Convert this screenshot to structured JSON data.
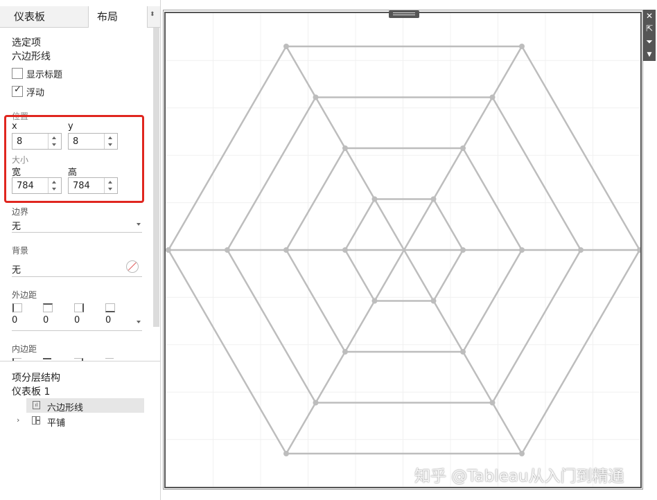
{
  "tabs": {
    "dashboard": "仪表板",
    "layout": "布局"
  },
  "selected": {
    "heading": "选定项",
    "name": "六边形线"
  },
  "options": {
    "show_title": "显示标题",
    "floating": "浮动",
    "floating_checked": true,
    "show_title_checked": false
  },
  "position": {
    "heading": "位置",
    "x_label": "x",
    "y_label": "y",
    "x": "8",
    "y": "8"
  },
  "size": {
    "heading": "大小",
    "w_label": "宽",
    "h_label": "高",
    "w": "784",
    "h": "784"
  },
  "border": {
    "heading": "边界",
    "value": "无"
  },
  "background": {
    "heading": "背景",
    "value": "无"
  },
  "outer_padding": {
    "heading": "外边距",
    "values": [
      "0",
      "0",
      "0",
      "0"
    ]
  },
  "inner_padding": {
    "heading": "内边距"
  },
  "hierarchy": {
    "heading": "项分层结构",
    "dashboard": "仪表板 1",
    "items": [
      "六边形线",
      "平铺"
    ]
  },
  "watermark": "知乎 @Tableau从入门到精通",
  "colors": {
    "highlight": "#e0261f",
    "line": "#bdbdbd",
    "selected_row": "#e6e6e6"
  },
  "toolbar_icons": [
    "close-icon",
    "open-external-icon",
    "filter-icon",
    "menu-arrow-icon"
  ]
}
